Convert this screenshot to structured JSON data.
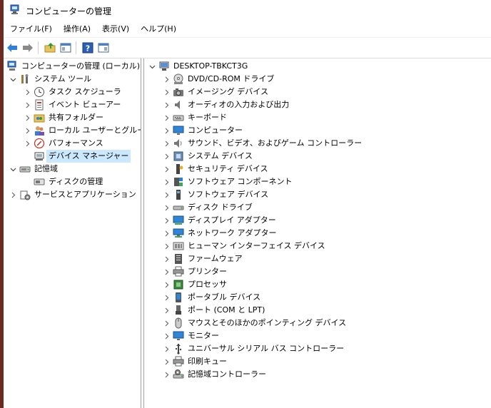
{
  "window": {
    "title": "コンピューターの管理"
  },
  "menu": [
    {
      "label": "ファイル(F)"
    },
    {
      "label": "操作(A)"
    },
    {
      "label": "表示(V)"
    },
    {
      "label": "ヘルプ(H)"
    }
  ],
  "toolbar": {
    "back_icon": "back-arrow-icon",
    "forward_icon": "forward-arrow-icon",
    "up_icon": "up-folder-icon",
    "console_icon": "show-hide-console-tree-icon",
    "help_icon": "help-icon",
    "actionpane_icon": "show-hide-action-pane-icon"
  },
  "tree": {
    "root": "コンピューターの管理 (ローカル)",
    "system_tools": "システム ツール",
    "items": [
      "タスク スケジューラ",
      "イベント ビューアー",
      "共有フォルダー",
      "ローカル ユーザーとグループ",
      "パフォーマンス",
      "デバイス マネージャー"
    ],
    "storage": "記憶域",
    "disk_mgmt": "ディスクの管理",
    "services": "サービスとアプリケーション"
  },
  "devices": {
    "root": "DESKTOP-TBKCT3G",
    "items": [
      "DVD/CD-ROM ドライブ",
      "イメージング デバイス",
      "オーディオの入力および出力",
      "キーボード",
      "コンピューター",
      "サウンド、ビデオ、およびゲーム コントローラー",
      "システム デバイス",
      "セキュリティ デバイス",
      "ソフトウェア コンポーネント",
      "ソフトウェア デバイス",
      "ディスク ドライブ",
      "ディスプレイ アダプター",
      "ネットワーク アダプター",
      "ヒューマン インターフェイス デバイス",
      "ファームウェア",
      "プリンター",
      "プロセッサ",
      "ポータブル デバイス",
      "ポート (COM と LPT)",
      "マウスとそのほかのポインティング デバイス",
      "モニター",
      "ユニバーサル シリアル バス コントローラー",
      "印刷キュー",
      "記憶域コントローラー"
    ]
  },
  "colors": {
    "selection": "#cce8ff",
    "accent": "#1e6fd9"
  }
}
